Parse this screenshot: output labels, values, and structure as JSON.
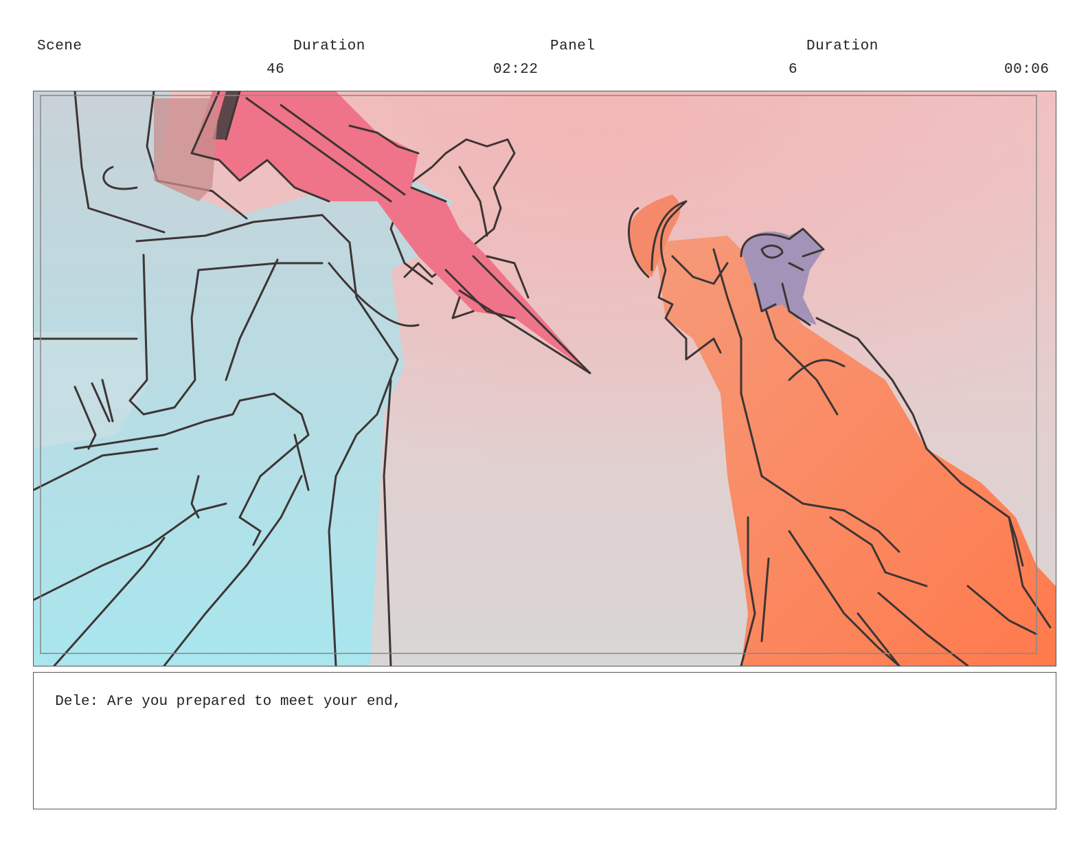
{
  "header": {
    "scene_label": "Scene",
    "scene_duration_label": "Duration",
    "panel_label": "Panel",
    "panel_duration_label": "Duration",
    "scene_number": "46",
    "scene_duration": "02:22",
    "panel_number": "6",
    "panel_duration": "00:06"
  },
  "notes": {
    "dialogue": "Dele: Are you prepared to meet your end,"
  },
  "colors": {
    "line": "#3d3535",
    "sky_top": "#f0c4c4",
    "sky_bottom": "#d9d6d6",
    "left_figure_top": "#c9d2d8",
    "left_figure_bottom": "#a9e6ee",
    "sword": "#f07489",
    "right_figure": "#fa8f6c",
    "cat": "#a493b8"
  }
}
